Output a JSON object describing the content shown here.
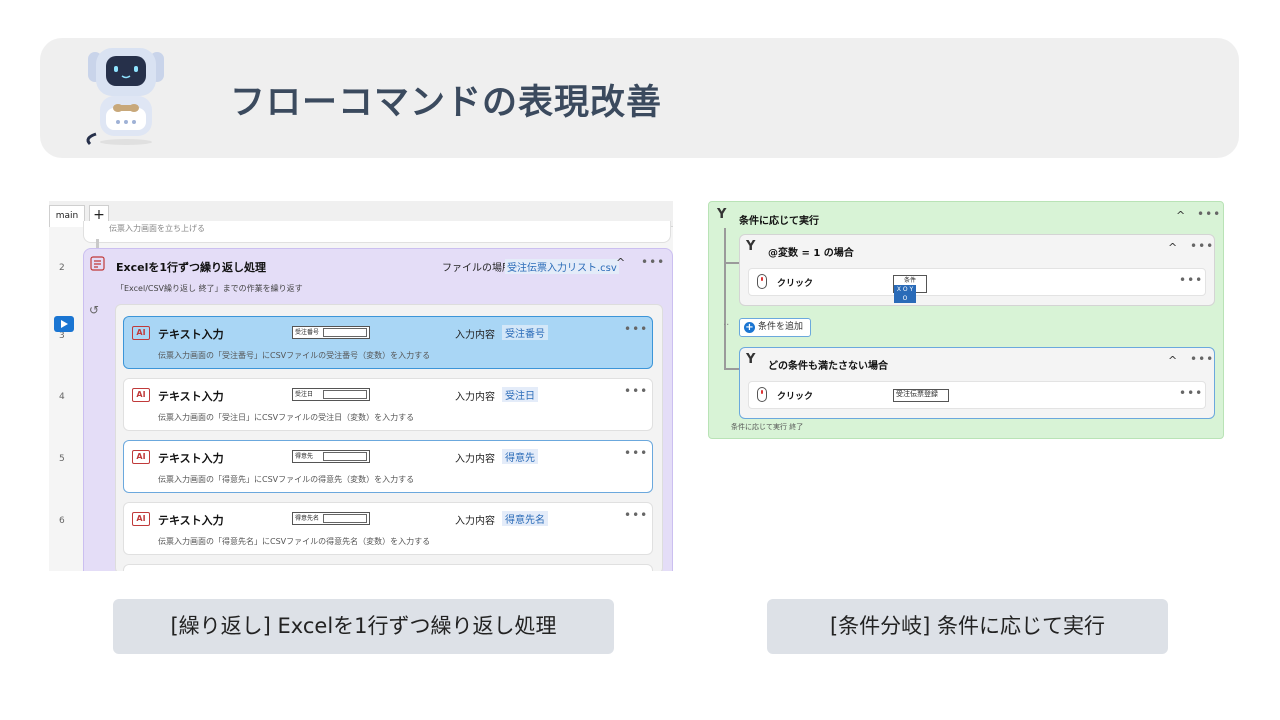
{
  "title": "フローコマンドの表現改善",
  "left_panel": {
    "tabs": {
      "main": "main",
      "add": "+"
    },
    "prev_step_text": "伝票入力画面を立ち上げる",
    "line_numbers": [
      "2",
      "3",
      "4",
      "5",
      "6"
    ],
    "loop": {
      "title": "Excelを1行ずつ繰り返し処理",
      "location_label": "ファイルの場所",
      "location_value": "受注伝票入力リスト.csv",
      "description": "「Excel/CSV繰り返し 終了」までの作業を繰り返す"
    },
    "steps": [
      {
        "title": "テキスト入力",
        "thumb": "受注番号",
        "input_label": "入力内容",
        "input_value": "受注番号",
        "description": "伝票入力画面の「受注番号」にCSVファイルの受注番号（変数）を入力する"
      },
      {
        "title": "テキスト入力",
        "thumb": "受注日",
        "input_label": "入力内容",
        "input_value": "受注日",
        "description": "伝票入力画面の「受注日」にCSVファイルの受注日（変数）を入力する"
      },
      {
        "title": "テキスト入力",
        "thumb": "得意先",
        "input_label": "入力内容",
        "input_value": "得意先",
        "description": "伝票入力画面の「得意先」にCSVファイルの得意先（変数）を入力する"
      },
      {
        "title": "テキスト入力",
        "thumb": "得意先名",
        "input_label": "入力内容",
        "input_value": "得意先名",
        "description": "伝票入力画面の「得意先名」にCSVファイルの得意先名（変数）を入力する"
      }
    ],
    "more": "•••",
    "chevron": "^"
  },
  "right_panel": {
    "branch_title": "条件に応じて実行",
    "case1_title": "@変数 = 1 の場合",
    "case1_action": "クリック",
    "case1_thumb_top": "条件",
    "case1_thumb_bottom": "X O Y O",
    "add_condition": "条件を追加",
    "case2_title": "どの条件も満たさない場合",
    "case2_action": "クリック",
    "case2_thumb": "受注伝票登録",
    "end_text": "条件に応じて実行 終了",
    "more": "•••",
    "chevron": "^"
  },
  "captions": {
    "left": "[繰り返し] Excelを1行ずつ繰り返し処理",
    "right": "[条件分岐] 条件に応じて実行"
  },
  "colors": {
    "title": "#3b4a5e",
    "loop_bg": "#e4ddf7",
    "branch_bg": "#d8f3d6",
    "selected": "#a9d6f5",
    "accent": "#1a75d2"
  }
}
